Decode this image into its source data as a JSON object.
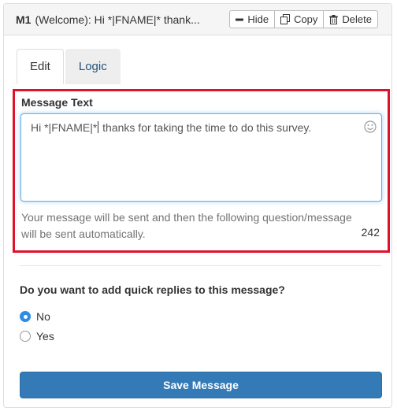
{
  "header": {
    "id": "M1",
    "title": "(Welcome): Hi *|FNAME|* thank...",
    "buttons": {
      "hide_label": "Hide",
      "copy_label": "Copy",
      "delete_label": "Delete"
    }
  },
  "tabs": [
    {
      "label": "Edit",
      "active": true
    },
    {
      "label": "Logic",
      "active": false
    }
  ],
  "message": {
    "label": "Message Text",
    "text_before_cursor": "Hi *|FNAME|*",
    "text_after_cursor": " thanks for taking the time to do this survey.",
    "help_text": "Your message will be sent and then the following question/message will be sent automatically.",
    "char_count": "242"
  },
  "quick_replies": {
    "question": "Do you want to add quick replies to this message?",
    "options": [
      {
        "label": "No",
        "checked": true
      },
      {
        "label": "Yes",
        "checked": false
      }
    ]
  },
  "save_label": "Save Message",
  "colors": {
    "accent": "#337ab7",
    "highlight_border": "#e0112b",
    "radio_checked": "#2e8ce6"
  },
  "icons": [
    "minus-icon",
    "copy-icon",
    "trash-icon",
    "smiley-icon"
  ]
}
